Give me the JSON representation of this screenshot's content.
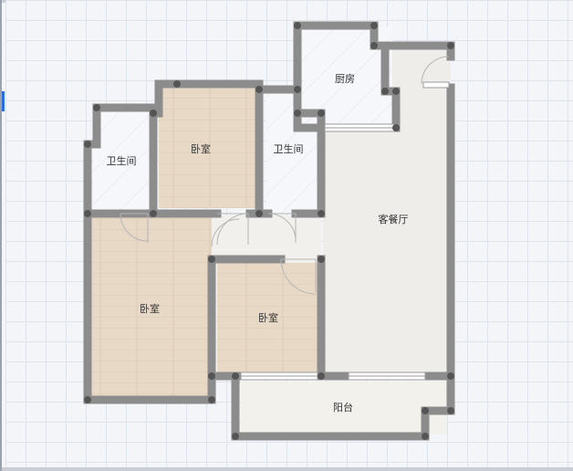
{
  "floorplan": {
    "rooms": {
      "kitchen": "厨房",
      "bathroom_left": "卫生间",
      "bedroom_top": "卧室",
      "bathroom_mid": "卫生间",
      "living_dining": "客餐厅",
      "bedroom_left": "卧室",
      "bedroom_mid": "卧室",
      "balcony": "阳台"
    }
  },
  "colors": {
    "wall": "#8c8c8c",
    "wall_joint": "#555555",
    "wood_floor": "#e8d8c6",
    "tile_floor": "#f6f7fa",
    "living_floor": "#efedea",
    "balcony_floor": "#f3f1ec",
    "grid_line": "#dfe3ea",
    "accent_tab": "#2d6cdf"
  }
}
